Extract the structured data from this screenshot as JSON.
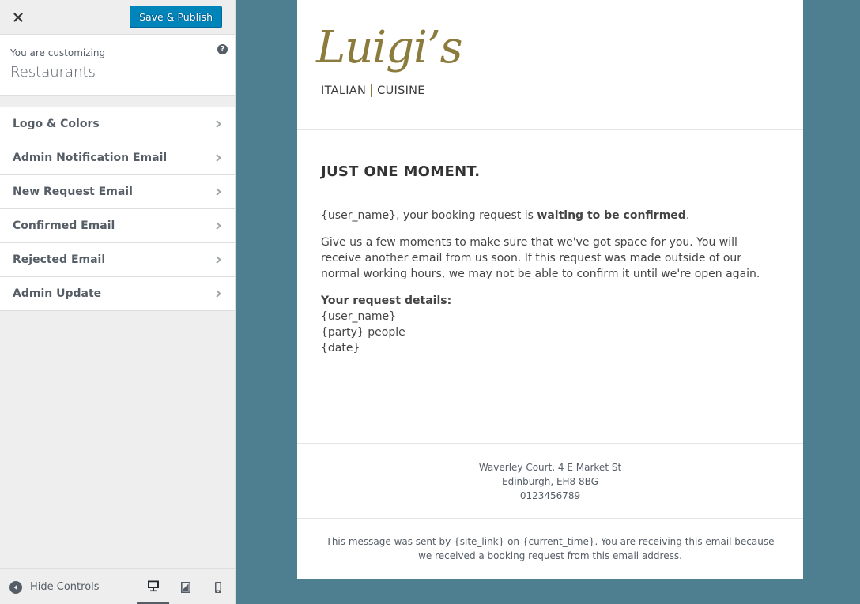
{
  "header": {
    "close_label": "×",
    "save_label": "Save & Publish"
  },
  "info": {
    "you_are_customizing": "You are customizing",
    "site_name": "Restaurants",
    "help_icon": "question-icon"
  },
  "sections": [
    {
      "label": "Logo & Colors"
    },
    {
      "label": "Admin Notification Email"
    },
    {
      "label": "New Request Email"
    },
    {
      "label": "Confirmed Email"
    },
    {
      "label": "Rejected Email"
    },
    {
      "label": "Admin Update"
    }
  ],
  "footer": {
    "hide_controls": "Hide Controls",
    "devices": [
      "desktop-icon",
      "tablet-icon",
      "mobile-icon"
    ],
    "active_device": "desktop"
  },
  "email": {
    "logo_script": "Luigi’s",
    "logo_left": "ITALIAN",
    "logo_right": "CUISINE",
    "title": "JUST ONE MOMENT.",
    "p1_start": "{user_name}, your booking request is ",
    "p1_bold": "waiting to be confirmed",
    "p1_end": ".",
    "p2": "Give us a few moments to make sure that we've got space for you. You will receive another email from us soon. If this request was made outside of our normal working hours, we may not be able to confirm it until we're open again.",
    "details_heading": "Your request details:",
    "detail_user": "{user_name}",
    "detail_party": "{party} people",
    "detail_date": "{date}",
    "address_line1": "Waverley Court, 4 E Market St",
    "address_line2": "Edinburgh, EH8 8BG",
    "phone": "0123456789",
    "disclaimer": "This message was sent by {site_link} on {current_time}. You are receiving this email because we received a booking request from this email address."
  },
  "colors": {
    "preview_bg": "#4e7f91",
    "primary_button": "#0085ba",
    "logo_gold": "#8b7b3c"
  }
}
